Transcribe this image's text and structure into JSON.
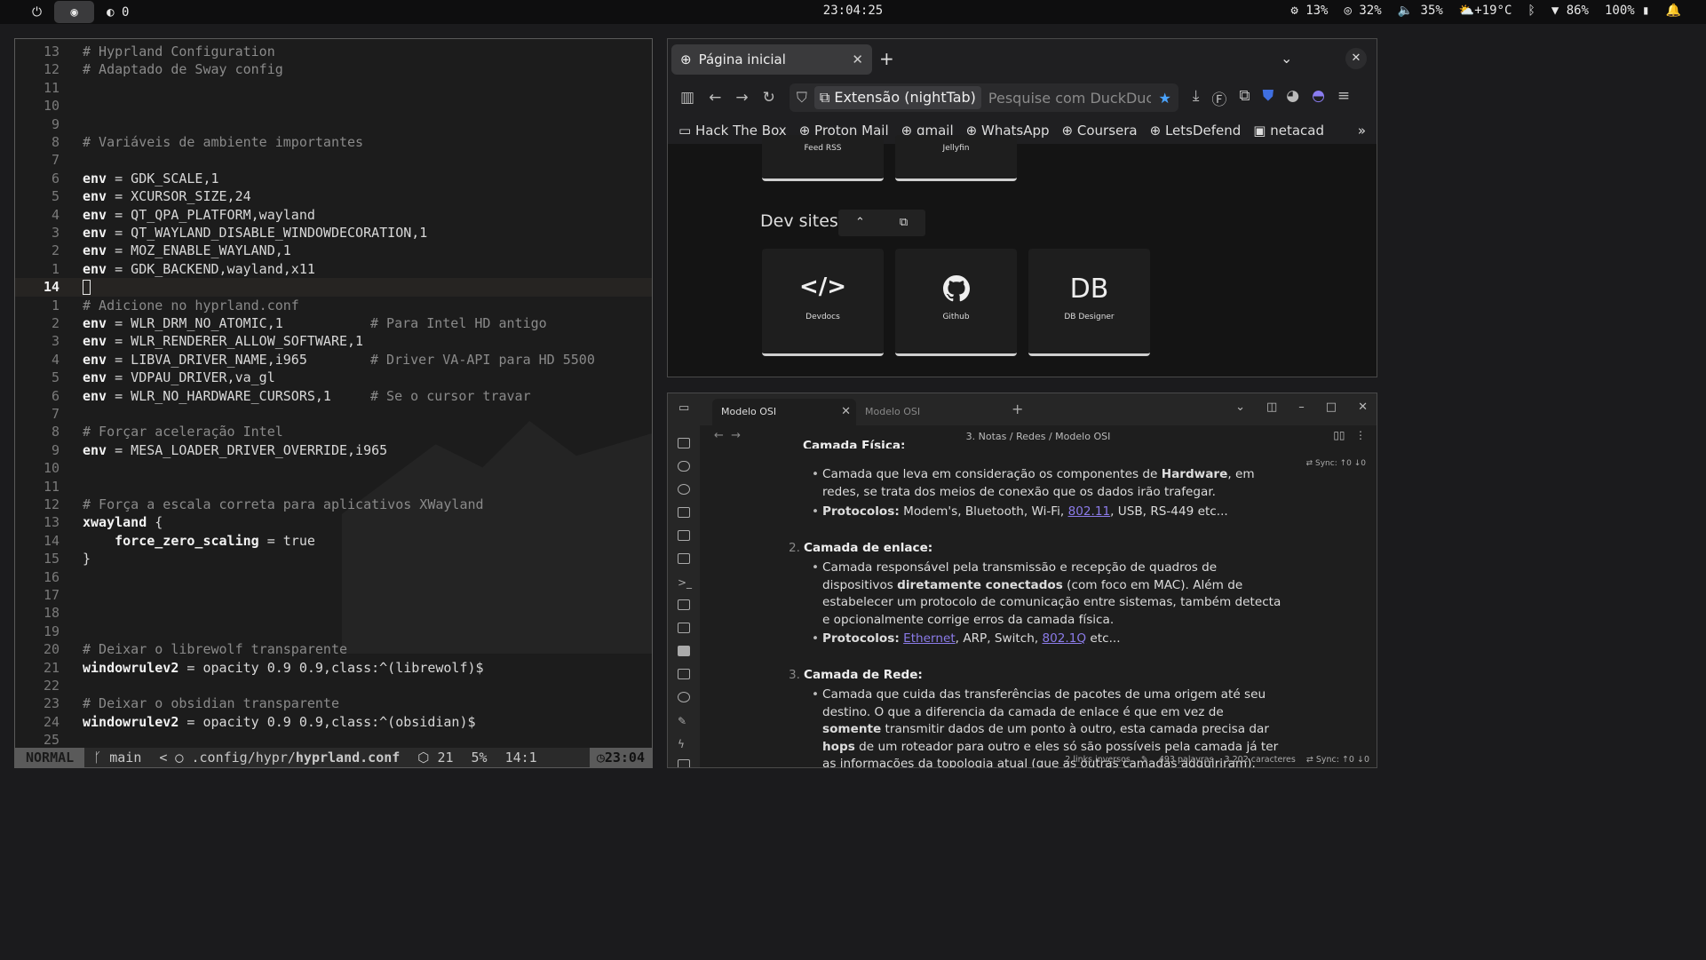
{
  "topbar": {
    "notif_count": "0",
    "clock": "23:04:25",
    "cpu": "13%",
    "memory": "32%",
    "volume": "35%",
    "weather": "+19°C",
    "wifi": "86%",
    "battery": "100%"
  },
  "editor": {
    "lines": [
      {
        "n": "13",
        "t": "# Hyprland Configuration"
      },
      {
        "n": "12",
        "t": "# Adaptado de Sway config"
      },
      {
        "n": "11",
        "t": ""
      },
      {
        "n": "10",
        "t": ""
      },
      {
        "n": "9",
        "t": ""
      },
      {
        "n": "8",
        "t": "# Variáveis de ambiente importantes"
      },
      {
        "n": "7",
        "t": ""
      },
      {
        "n": "6",
        "k": "env",
        "t": " = GDK_SCALE,1"
      },
      {
        "n": "5",
        "k": "env",
        "t": " = XCURSOR_SIZE,24"
      },
      {
        "n": "4",
        "k": "env",
        "t": " = QT_QPA_PLATFORM,wayland"
      },
      {
        "n": "3",
        "k": "env",
        "t": " = QT_WAYLAND_DISABLE_WINDOWDECORATION,1"
      },
      {
        "n": "2",
        "k": "env",
        "t": " = MOZ_ENABLE_WAYLAND,1"
      },
      {
        "n": "1",
        "k": "env",
        "t": " = GDK_BACKEND,wayland,x11"
      },
      {
        "n": "14",
        "t": "",
        "cursor": true
      },
      {
        "n": "1",
        "t": "# Adicione no hyprland.conf"
      },
      {
        "n": "2",
        "k": "env",
        "t": " = WLR_DRM_NO_ATOMIC,1",
        "c": "# Para Intel HD antigo"
      },
      {
        "n": "3",
        "k": "env",
        "t": " = WLR_RENDERER_ALLOW_SOFTWARE,1"
      },
      {
        "n": "4",
        "k": "env",
        "t": " = LIBVA_DRIVER_NAME,i965",
        "c": "# Driver VA-API para HD 5500"
      },
      {
        "n": "5",
        "k": "env",
        "t": " = VDPAU_DRIVER,va_gl"
      },
      {
        "n": "6",
        "k": "env",
        "t": " = WLR_NO_HARDWARE_CURSORS,1",
        "c": "# Se o cursor travar"
      },
      {
        "n": "7",
        "t": ""
      },
      {
        "n": "8",
        "t": "# Forçar aceleração Intel"
      },
      {
        "n": "9",
        "k": "env",
        "t": " = MESA_LOADER_DRIVER_OVERRIDE,i965"
      },
      {
        "n": "10",
        "t": ""
      },
      {
        "n": "11",
        "t": ""
      },
      {
        "n": "12",
        "t": "# Força a escala correta para aplicativos XWayland"
      },
      {
        "n": "13",
        "k": "xwayland",
        "t": " {"
      },
      {
        "n": "14",
        "k": "    force_zero_scaling",
        "t": " = true"
      },
      {
        "n": "15",
        "t": "}"
      },
      {
        "n": "16",
        "t": ""
      },
      {
        "n": "17",
        "t": ""
      },
      {
        "n": "18",
        "t": ""
      },
      {
        "n": "19",
        "t": ""
      },
      {
        "n": "20",
        "t": "# Deixar o librewolf transparente"
      },
      {
        "n": "21",
        "k": "windowrulev2",
        "t": " = opacity 0.9 0.9,class:^(librewolf)$"
      },
      {
        "n": "22",
        "t": ""
      },
      {
        "n": "23",
        "t": "# Deixar o obsidian transparente"
      },
      {
        "n": "24",
        "k": "windowrulev2",
        "t": " = opacity 0.9 0.9,class:^(obsidian)$"
      },
      {
        "n": "25",
        "t": ""
      }
    ],
    "status": {
      "mode": "NORMAL",
      "branch": "main",
      "path_prefix": ".config/hypr/",
      "filename": "hyprland.conf",
      "diag": "21",
      "percent": "5%",
      "position": "14:1",
      "time": "23:04"
    }
  },
  "browser": {
    "tab_title": "Página inicial",
    "url_chip": "Extensão (nightTab)",
    "search_placeholder": "Pesquise com DuckDuckGo",
    "bookmarks": [
      "Hack The Box",
      "Proton Mail",
      "gmail",
      "WhatsApp",
      "Coursera",
      "LetsDefend",
      "netacad"
    ],
    "top_tiles": [
      "Feed RSS",
      "Jellyfin"
    ],
    "section": "Dev sites",
    "dev_tiles": [
      {
        "label": "Devdocs",
        "icon": "</>"
      },
      {
        "label": "Github",
        "icon": "github"
      },
      {
        "label": "DB Designer",
        "icon": "DB"
      }
    ]
  },
  "obsidian": {
    "tab1": "Modelo OSI",
    "tab2": "Modelo OSI",
    "breadcrumb": "3. Notas / Redes / Modelo OSI",
    "partial_heading": "Camada Física:",
    "sec1_b1_a": "Camada que leva em consideração os componentes de ",
    "sec1_b1_bold": "Hardware",
    "sec1_b1_b": ", em redes, se trata dos meios de conexão que os dados irão trafegar.",
    "sec1_b2_label": "Protocolos:",
    "sec1_b2_a": " Modem's, Bluetooth, Wi-Fi, ",
    "sec1_b2_link": "802.11",
    "sec1_b2_b": ", USB, RS-449 etc...",
    "sec2_num": "2.",
    "sec2_title": "Camada de enlace:",
    "sec2_b1_a": "Camada responsável pela transmissão e recepção de quadros de dispositivos ",
    "sec2_b1_bold": "diretamente conectados",
    "sec2_b1_b": " (com foco em MAC). Além de estabelecer um protocolo de comunicação entre sistemas, também detecta e opcionalmente corrige erros da camada física.",
    "sec2_b2_label": "Protocolos:",
    "sec2_b2_link1": "Ethernet",
    "sec2_b2_mid": ", ARP, Switch, ",
    "sec2_b2_link2": "802.1Q",
    "sec2_b2_end": " etc...",
    "sec3_num": "3.",
    "sec3_title": "Camada de Rede:",
    "sec3_b1_a": "Camada que cuida das transferências de pacotes de uma origem até seu destino. O que a diferencia da camada de enlace é que em vez de ",
    "sec3_b1_bold1": "somente",
    "sec3_b1_b": " transmitir dados de um ponto à outro, esta camada precisa dar ",
    "sec3_b1_bold2": "hops",
    "sec3_b1_c": " de um roteador para outro e eles só são possíveis pela camada já ter as informações da topologia atual (que as outras camadas adquiriram).",
    "sync": "Sync: ↑0 ↓0",
    "backlinks": "2 links inversos",
    "words": "493 palavras",
    "chars": "3.202 caracteres"
  }
}
